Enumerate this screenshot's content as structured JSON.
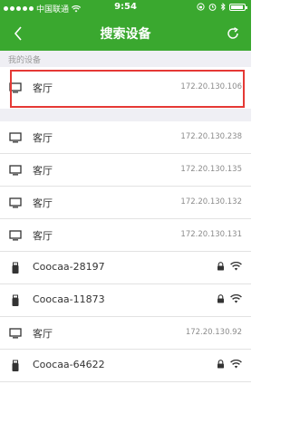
{
  "statusbar": {
    "carrier": "中国联通",
    "time": "9:54"
  },
  "navbar": {
    "title": "搜索设备"
  },
  "my_devices": {
    "section_title": "我的设备",
    "item": {
      "name": "客厅",
      "ip": "172.20.130.106",
      "icon": "monitor-icon"
    }
  },
  "devices": [
    {
      "name": "客厅",
      "ip": "172.20.130.238",
      "icon": "monitor-icon",
      "locked": false
    },
    {
      "name": "客厅",
      "ip": "172.20.130.135",
      "icon": "monitor-icon",
      "locked": false
    },
    {
      "name": "客厅",
      "ip": "172.20.130.132",
      "icon": "monitor-icon",
      "locked": false
    },
    {
      "name": "客厅",
      "ip": "172.20.130.131",
      "icon": "monitor-icon",
      "locked": false
    },
    {
      "name": "Coocaa-28197",
      "ip": "",
      "icon": "usb-stick-icon",
      "locked": true
    },
    {
      "name": "Coocaa-11873",
      "ip": "",
      "icon": "usb-stick-icon",
      "locked": true
    },
    {
      "name": "客厅",
      "ip": "172.20.130.92",
      "icon": "monitor-icon",
      "locked": false
    },
    {
      "name": "Coocaa-64622",
      "ip": "",
      "icon": "usb-stick-icon",
      "locked": true
    }
  ],
  "colors": {
    "header": "#3aa82f",
    "highlight": "#e53935",
    "section_bg": "#efeff4"
  }
}
